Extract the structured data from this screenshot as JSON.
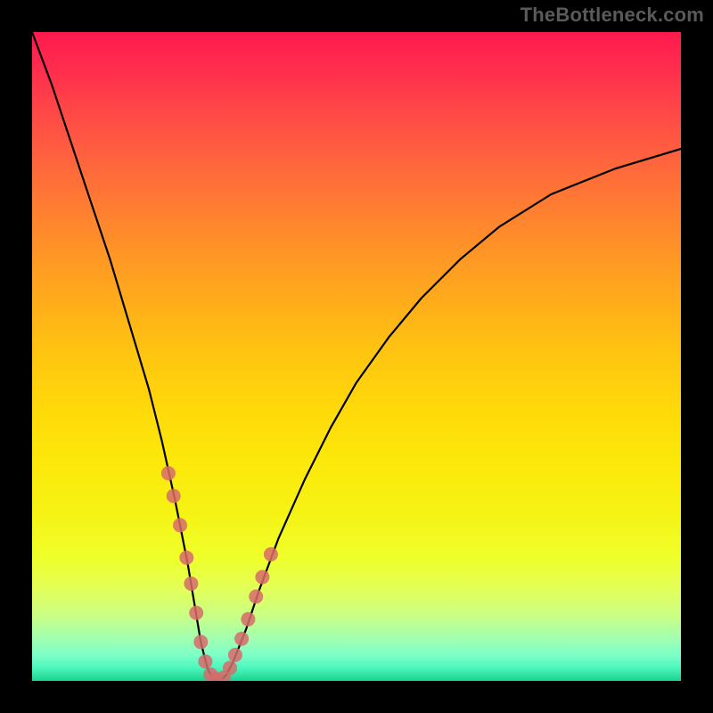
{
  "watermark": "TheBottleneck.com",
  "colors": {
    "curve": "#000000",
    "marker_fill": "#d76b6b",
    "marker_stroke": "#a64848",
    "plot_border": "#000000"
  },
  "chart_data": {
    "type": "line",
    "title": "",
    "xlabel": "",
    "ylabel": "",
    "xlim": [
      0,
      100
    ],
    "ylim": [
      0,
      100
    ],
    "series": [
      {
        "name": "bottleneck-curve",
        "x": [
          0,
          3,
          6,
          9,
          12,
          15,
          18,
          20,
          22,
          24,
          25,
          26,
          27,
          28,
          29,
          30,
          31,
          33,
          35,
          38,
          42,
          46,
          50,
          55,
          60,
          66,
          72,
          80,
          90,
          100
        ],
        "values": [
          100,
          92,
          83,
          74,
          65,
          55,
          45,
          37,
          28,
          18,
          12,
          6,
          2,
          0,
          0,
          1,
          3,
          8,
          14,
          22,
          31,
          39,
          46,
          53,
          59,
          65,
          70,
          75,
          79,
          82
        ]
      }
    ],
    "markers": {
      "name": "highlighted-points",
      "x": [
        21.0,
        21.8,
        22.8,
        23.8,
        24.5,
        25.3,
        26.0,
        26.7,
        27.5,
        28.3,
        29.5,
        30.5,
        31.3,
        32.3,
        33.3,
        34.5,
        35.5,
        36.8
      ],
      "values": [
        32.0,
        28.5,
        24.0,
        19.0,
        15.0,
        10.5,
        6.0,
        3.0,
        1.0,
        0.3,
        0.5,
        2.0,
        4.0,
        6.5,
        9.5,
        13.0,
        16.0,
        19.5
      ]
    }
  }
}
